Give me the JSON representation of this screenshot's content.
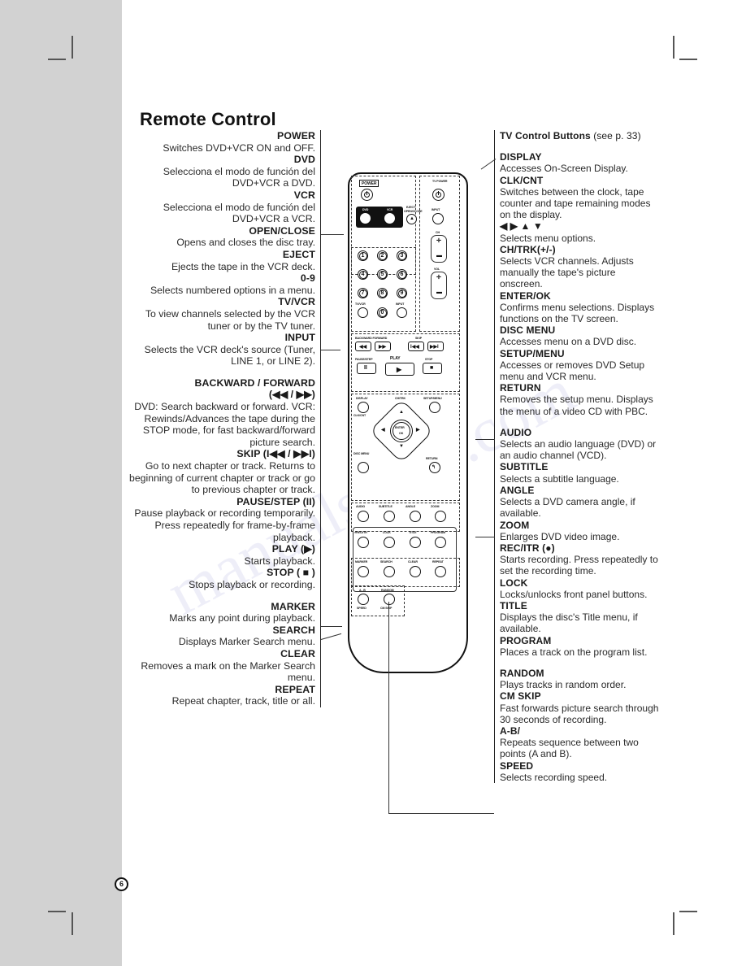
{
  "page": {
    "title": "Remote Control",
    "number": "6",
    "watermark": "manualsbase.com"
  },
  "left_column": [
    {
      "key": "POWER",
      "desc": "Switches DVD+VCR ON and OFF."
    },
    {
      "key": "DVD",
      "desc": "Selecciona el modo de función del DVD+VCR a DVD."
    },
    {
      "key": "VCR",
      "desc": "Selecciona el modo de función del DVD+VCR a VCR."
    },
    {
      "key": "OPEN/CLOSE",
      "desc": "Opens and closes the disc tray."
    },
    {
      "key": "EJECT",
      "desc": "Ejects the tape in the VCR deck."
    },
    {
      "key": "0-9",
      "desc": "Selects numbered options in a menu."
    },
    {
      "key": "TV/VCR",
      "desc": "To view channels selected by the VCR tuner or by the TV tuner."
    },
    {
      "key": "INPUT",
      "desc": "Selects the VCR deck's source (Tuner, LINE 1, or LINE 2)."
    },
    {
      "key": "BACKWARD / FORWARD",
      "key2": "(◀◀ / ▶▶)",
      "desc": "DVD: Search backward or forward. VCR: Rewinds/Advances the tape during the STOP mode, for fast backward/forward picture search.",
      "gap": true
    },
    {
      "key": "SKIP (I◀◀ / ▶▶I)",
      "desc": "Go to next chapter or track. Returns to beginning of current chapter or track or go to previous chapter or track."
    },
    {
      "key": "PAUSE/STEP (II)",
      "desc": "Pause playback or recording temporarily. Press repeatedly for frame-by-frame playback."
    },
    {
      "key": "PLAY (▶)",
      "desc": "Starts playback."
    },
    {
      "key": "STOP ( ■ )",
      "desc": "Stops playback or recording."
    },
    {
      "key": "MARKER",
      "desc": "Marks any point during playback.",
      "gap": true
    },
    {
      "key": "SEARCH",
      "desc": "Displays Marker Search menu."
    },
    {
      "key": "CLEAR",
      "desc": "Removes a mark on the Marker Search menu."
    },
    {
      "key": "REPEAT",
      "desc": "Repeat chapter, track, title or all."
    }
  ],
  "right_column": [
    {
      "key": "TV Control Buttons",
      "sub": "(see p. 33)",
      "desc": ""
    },
    {
      "key": "DISPLAY",
      "desc": "Accesses On-Screen Display.",
      "gap": true
    },
    {
      "key": "CLK/CNT",
      "desc": "Switches between the clock, tape counter and tape remaining modes on the display."
    },
    {
      "key": "◀ ▶ ▲ ▼",
      "desc": "Selects menu options."
    },
    {
      "key": "CH/TRK(+/-)",
      "desc": "Selects VCR channels. Adjusts manually the tape's picture onscreen."
    },
    {
      "key": "ENTER/OK",
      "desc": "Confirms menu selections. Displays functions on the TV screen."
    },
    {
      "key": "DISC MENU",
      "desc": "Accesses menu on a DVD disc."
    },
    {
      "key": "SETUP/MENU",
      "desc": "Accesses or removes DVD Setup menu and VCR menu."
    },
    {
      "key": "RETURN",
      "desc": "Removes the setup menu. Displays the menu of a video CD with PBC."
    },
    {
      "key": "AUDIO",
      "desc": "Selects an audio language (DVD) or an audio channel (VCD).",
      "gap": true
    },
    {
      "key": "SUBTITLE",
      "desc": "Selects a subtitle language."
    },
    {
      "key": "ANGLE",
      "desc": "Selects a DVD camera angle, if available."
    },
    {
      "key": "ZOOM",
      "desc": "Enlarges DVD video image."
    },
    {
      "key": "REC/ITR (●)",
      "desc": "Starts recording. Press repeatedly to set the recording time."
    },
    {
      "key": "LOCK",
      "desc": "Locks/unlocks front panel buttons."
    },
    {
      "key": "TITLE",
      "desc": "Displays the disc's Title menu, if available."
    },
    {
      "key": "PROGRAM",
      "desc": "Places a track on the program list."
    },
    {
      "key": "RANDOM",
      "desc": "Plays tracks in random order.",
      "gap": true
    },
    {
      "key": "CM SKIP",
      "desc": "Fast forwards picture search through 30 seconds of recording."
    },
    {
      "key": "A-B/",
      "desc": "Repeats sequence between two points (A and B)."
    },
    {
      "key": "SPEED",
      "desc": "Selects recording speed."
    }
  ],
  "remote": {
    "labels": {
      "power": "POWER",
      "dvd": "DVD",
      "vcr": "VCR",
      "eject": "EJECT",
      "open_close": "OPEN/CLOSE",
      "tv_power": "TV POWER",
      "input_top": "INPUT",
      "ch": "CH",
      "vol": "VOL",
      "tv_vcr": "TV/VCR",
      "input_bottom": "INPUT",
      "backward_forward": "BACKWARD  FORWARD",
      "skip": "SKIP",
      "pause_step": "PAUSE/STEP",
      "play": "PLAY",
      "stop": "STOP",
      "display": "DISPLAY",
      "clk_cnt": "CLK/CNT",
      "ch_trk": "CH/TRK",
      "setup_menu": "SETUP/MENU",
      "disc_menu": "DISC MENU",
      "return": "RETURN",
      "enter": "ENTER",
      "ok": "OK",
      "audio": "AUDIO",
      "subtitle": "SUBTITLE",
      "angle": "ANGLE",
      "zoom": "ZOOM",
      "rec_itr": "●REC/ITR",
      "lock": "LOCK",
      "title": "TITLE",
      "program": "PROGRAM",
      "marker": "MARKER",
      "search": "SEARCH",
      "clear": "CLEAR",
      "repeat": "REPEAT",
      "ab": "A - B",
      "random": "RANDOM",
      "speed": "SPEED",
      "cm_skip": "CM SKIP"
    },
    "keypad": [
      "1",
      "2",
      "3",
      "4",
      "5",
      "6",
      "7",
      "8",
      "9",
      "0"
    ]
  }
}
